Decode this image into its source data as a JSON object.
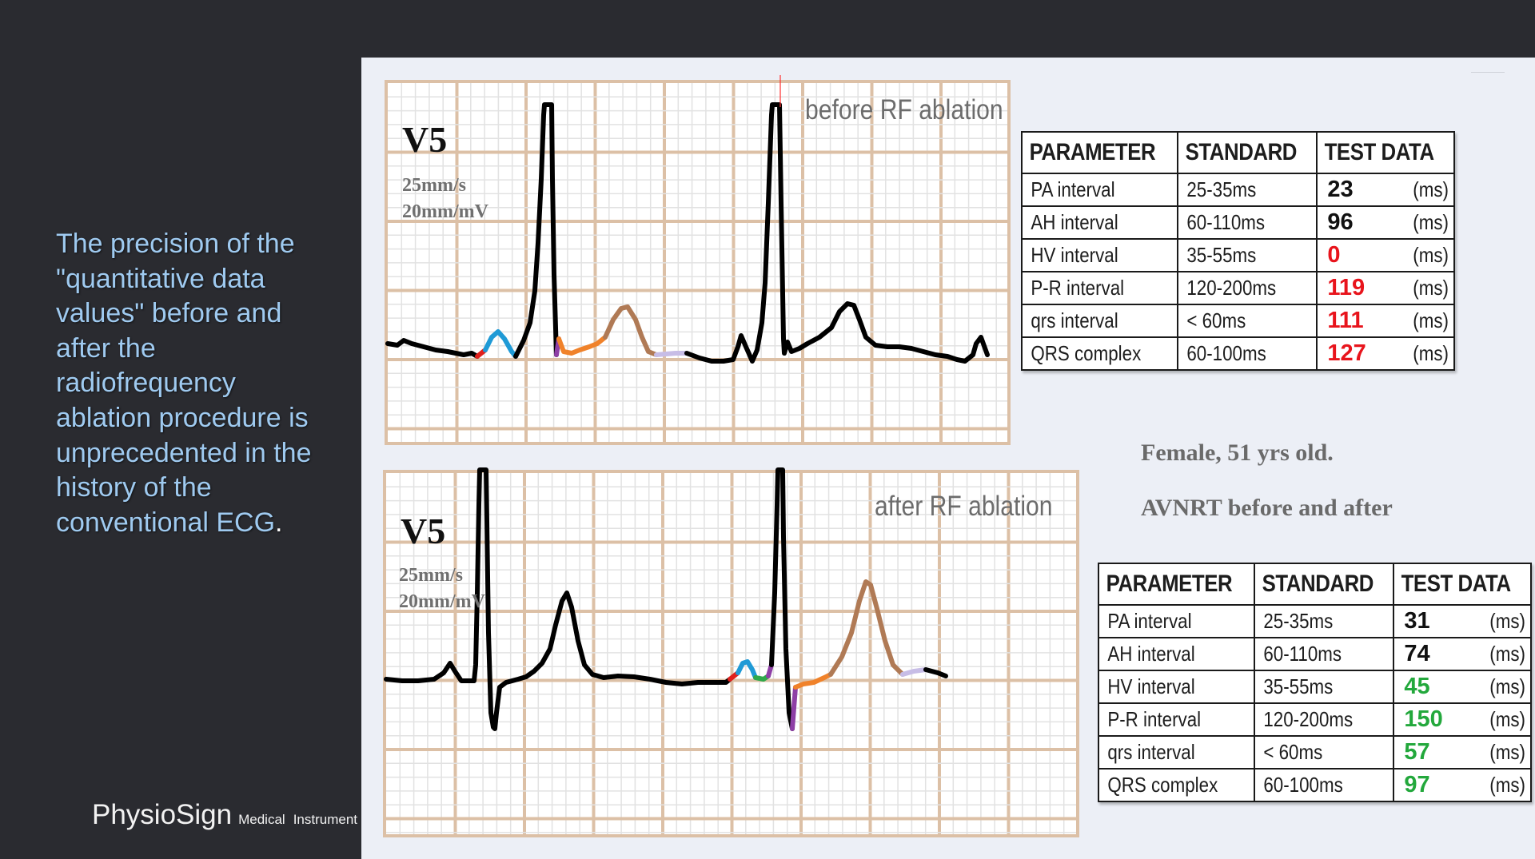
{
  "sidebar": {
    "description_lines": [
      "The precision of the",
      "\"quantitative data",
      "values\" before and",
      "after the",
      "radiofrequency",
      "ablation procedure is",
      "unprecedented in the",
      "history of the",
      "conventional ECG"
    ],
    "description_period": ".",
    "brand_name": "PhysioSign",
    "brand_sub_1": "Medical",
    "brand_sub_2": "Instrument"
  },
  "ecg_before": {
    "lead": "V5",
    "speed": "25mm/s",
    "gain": "20mm/mV",
    "state_label": "before RF ablation"
  },
  "ecg_after": {
    "lead": "V5",
    "speed": "25mm/s",
    "gain": "20mm/mV",
    "state_label": "after RF ablation"
  },
  "patient": {
    "info": "Female, 51 yrs old.",
    "condition": "AVNRT before and after"
  },
  "colors": {
    "abnormal": "#e8141c",
    "normal": "#23a83c",
    "neutral": "#111111",
    "grid_major": "#dcc0a6",
    "grid_minor": "#e2e2e2",
    "trace": "#000000",
    "segment_red": "#e0201c",
    "segment_blue": "#1f9ad6",
    "segment_green": "#2fa84a",
    "segment_purple": "#8e3fa6",
    "segment_orange": "#f0822a",
    "segment_brown": "#b07a55",
    "segment_lavender": "#c7bde6"
  },
  "table_headers": [
    "PARAMETER",
    "STANDARD",
    "TEST DATA"
  ],
  "table_before": [
    {
      "parameter": "PA interval",
      "standard": "25-35ms",
      "value": "23",
      "unit": "(ms)",
      "status": "neutral"
    },
    {
      "parameter": "AH interval",
      "standard": "60-110ms",
      "value": "96",
      "unit": "(ms)",
      "status": "neutral"
    },
    {
      "parameter": "HV interval",
      "standard": "35-55ms",
      "value": "0",
      "unit": "(ms)",
      "status": "abnormal"
    },
    {
      "parameter": "P-R interval",
      "standard": "120-200ms",
      "value": "119",
      "unit": "(ms)",
      "status": "abnormal"
    },
    {
      "parameter": "qrs  interval",
      "standard": "< 60ms",
      "value": "111",
      "unit": "(ms)",
      "status": "abnormal"
    },
    {
      "parameter": "QRS complex",
      "standard": "60-100ms",
      "value": "127",
      "unit": "(ms)",
      "status": "abnormal"
    }
  ],
  "table_after": [
    {
      "parameter": "PA interval",
      "standard": "25-35ms",
      "value": "31",
      "unit": "(ms)",
      "status": "neutral"
    },
    {
      "parameter": "AH interval",
      "standard": "60-110ms",
      "value": "74",
      "unit": "(ms)",
      "status": "neutral"
    },
    {
      "parameter": "HV interval",
      "standard": "35-55ms",
      "value": "45",
      "unit": "(ms)",
      "status": "normal"
    },
    {
      "parameter": "P-R interval",
      "standard": "120-200ms",
      "value": "150",
      "unit": "(ms)",
      "status": "normal"
    },
    {
      "parameter": "qrs  interval",
      "standard": "< 60ms",
      "value": "57",
      "unit": "(ms)",
      "status": "normal"
    },
    {
      "parameter": "QRS complex",
      "standard": "60-100ms",
      "value": "97",
      "unit": "(ms)",
      "status": "normal"
    }
  ]
}
